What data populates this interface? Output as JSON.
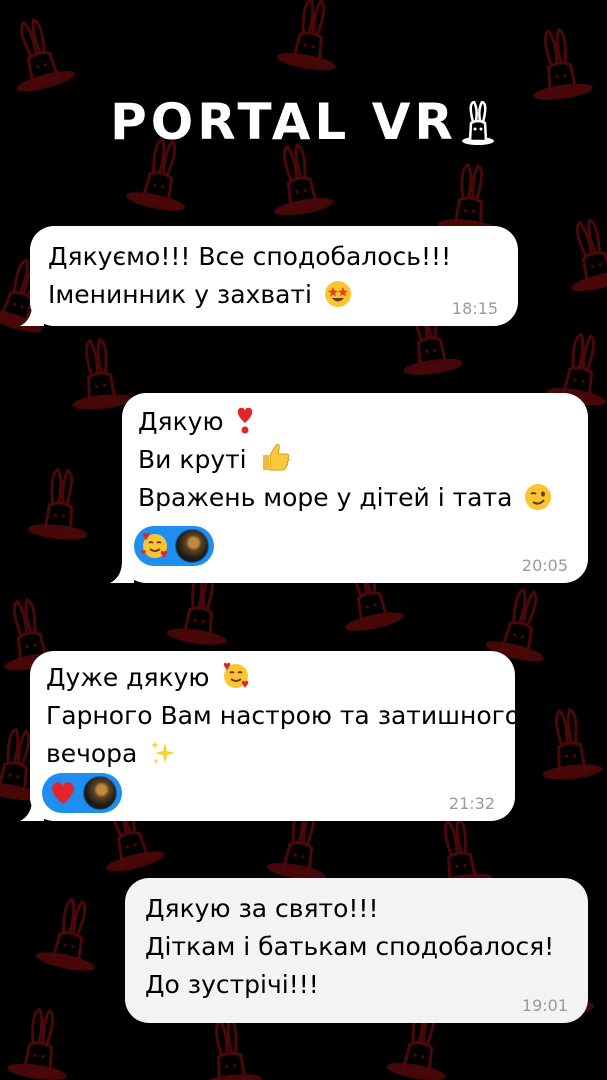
{
  "brand": {
    "logo_text": "PORTAL VR"
  },
  "colors": {
    "background": "#000000",
    "pattern": "#8b0f12",
    "bubble": "#ffffff",
    "reaction_pill": "#1e8fef",
    "timestamp": "#9a9a9a"
  },
  "messages": [
    {
      "lines": [
        "Дякуємо!!! Все сподобалось!!!",
        "Іменинник у захваті"
      ],
      "emoji": "star-struck-emoji",
      "time": "18:15"
    },
    {
      "lines": [
        "Дякую",
        "Ви круті",
        "Вражень море у дітей і тата"
      ],
      "emoji": [
        "heart-exclamation-emoji",
        "thumbs-up-emoji",
        "winking-face-emoji"
      ],
      "reactions": [
        "smiling-face-with-hearts-emoji",
        "user-avatar"
      ],
      "time": "20:05"
    },
    {
      "lines": [
        "Дуже дякую",
        "Гарного Вам настрою та затишного",
        "вечора"
      ],
      "emoji": [
        "smiling-face-with-hearts-emoji",
        "sparkles-emoji"
      ],
      "reactions": [
        "red-heart-emoji",
        "user-avatar"
      ],
      "time": "21:32"
    },
    {
      "lines": [
        "Дякую за свято!!!",
        "Діткам і батькам сподобалося!",
        "До зустрічі!!!"
      ],
      "time": "19:01"
    }
  ]
}
